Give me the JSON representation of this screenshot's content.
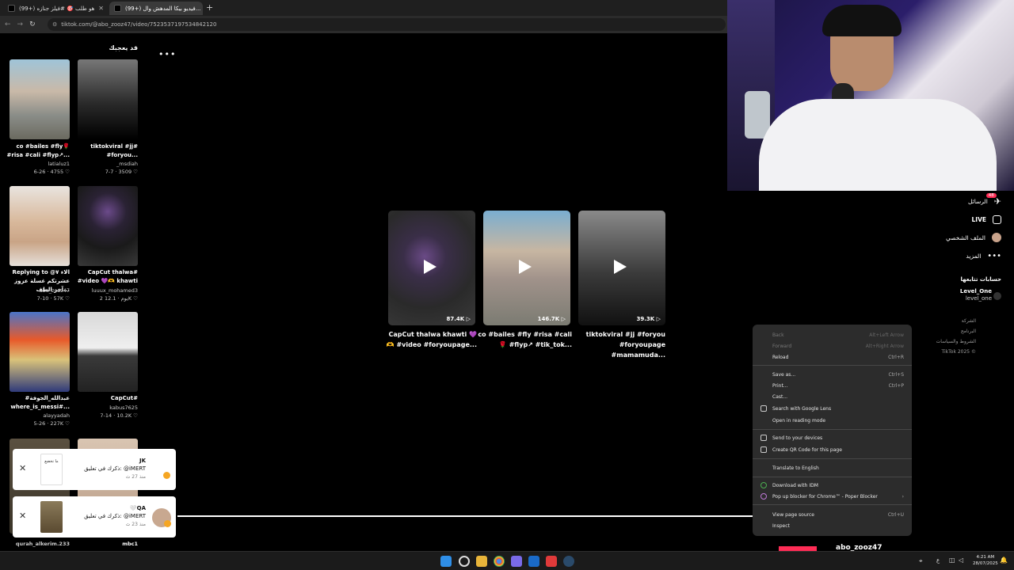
{
  "browser": {
    "tabs": [
      {
        "label": "(99+) هو طلب 🎯 #فيلز جنازه",
        "active": false
      },
      {
        "label": "(99+) فيديو بيكا المدهش وال...",
        "active": true
      }
    ],
    "url": "tiktok.com/@abo_zooz47/video/7523537197534842120"
  },
  "grid": {
    "title": "قد يعجبك",
    "items": [
      {
        "caption": "co #bailes #fly🌹 #risa #cali #flyp↗...",
        "user": "latialuz1",
        "stats": "6-26 · 4755 ♡"
      },
      {
        "caption": "tiktokviral #jj# #foryou...",
        "user": "_msdiah",
        "stats": "7-7 · 3509 ♡"
      },
      {
        "caption": "Replying to @الاء ٧ عشرتكم غسلة عزوز آخر الطف...",
        "user": "abo_zooz47",
        "stats": "7-10 · 57K ♡"
      },
      {
        "caption": "CapCut thalwa# #video 💜🫶 khawti",
        "user": "luuux_mohamed3",
        "stats": "2 يوم · 12.1K ♡"
      },
      {
        "caption": "#عبدالله_الجوفة where_is_messi#...",
        "user": "alayyadah",
        "stats": "5-26 · 227K ♡"
      },
      {
        "caption": "CapCut#",
        "user": "kabus7625",
        "stats": "7-14 · 10.2K ♡"
      },
      {
        "caption": "",
        "user": "qurah_alkerim.233",
        "stats": ""
      },
      {
        "caption": "",
        "user": "mbc1",
        "stats": ""
      }
    ]
  },
  "videos": [
    {
      "count": "87.4K",
      "caption": "CapCut thalwa khawti 💜🫶 #video #foryoupage..."
    },
    {
      "count": "146.7K",
      "caption": "co #bailes #fly #risa #cali🌹 #flyp↗ #tik_tok..."
    },
    {
      "count": "39.3K",
      "caption": "tiktokviral #jj #foryou #foryoupage #mamamuda..."
    }
  ],
  "sidebar": {
    "messages_label": "الرسائل",
    "messages_badge": "48",
    "live_label": "LIVE",
    "profile_label": "الملف الشخصي",
    "more_label": "المزيد",
    "following_title": "حسابات تتابعها",
    "following_name": "Level_One",
    "following_handle": "level_one",
    "footer_company": "الشركة",
    "footer_program": "البرنامج",
    "footer_terms": "الشروط والسياسات",
    "footer_copy": "TikTok 2025 ©"
  },
  "context_menu": [
    {
      "label": "Back",
      "shortcut": "Alt+Left Arrow",
      "disabled": true
    },
    {
      "label": "Forward",
      "shortcut": "Alt+Right Arrow",
      "disabled": true
    },
    {
      "label": "Reload",
      "shortcut": "Ctrl+R",
      "disabled": false
    },
    {
      "label": "Save as...",
      "shortcut": "Ctrl+S",
      "disabled": false
    },
    {
      "label": "Print...",
      "shortcut": "Ctrl+P",
      "disabled": false
    },
    {
      "label": "Cast...",
      "shortcut": "",
      "disabled": false
    },
    {
      "label": "Search with Google Lens",
      "shortcut": "",
      "disabled": false
    },
    {
      "label": "Open in reading mode",
      "shortcut": "",
      "disabled": false
    },
    {
      "label": "Send to your devices",
      "shortcut": "",
      "disabled": false
    },
    {
      "label": "Create QR Code for this page",
      "shortcut": "",
      "disabled": false
    },
    {
      "label": "Translate to English",
      "shortcut": "",
      "disabled": false
    },
    {
      "label": "Download with IDM",
      "shortcut": "",
      "disabled": false
    },
    {
      "label": "Pop up blocker for Chrome™ - Poper Blocker",
      "shortcut": "›",
      "disabled": false
    },
    {
      "label": "View page source",
      "shortcut": "Ctrl+U",
      "disabled": false
    },
    {
      "label": "Inspect",
      "shortcut": "",
      "disabled": false
    }
  ],
  "notifications": [
    {
      "thumb_text": "ما تخضع",
      "name": "JK",
      "text": "ذكرك في تعليق: @iMERT",
      "time": "منذ 27 ث"
    },
    {
      "thumb_text": "",
      "name": "🤍QA",
      "text": "ذكرك في تعليق: @iMERT",
      "time": "منذ 23 ث"
    }
  ],
  "author_name": "abo_zooz47",
  "taskbar": {
    "lang": "ع",
    "time": "4:21 AM",
    "date": "28/07/2025"
  }
}
